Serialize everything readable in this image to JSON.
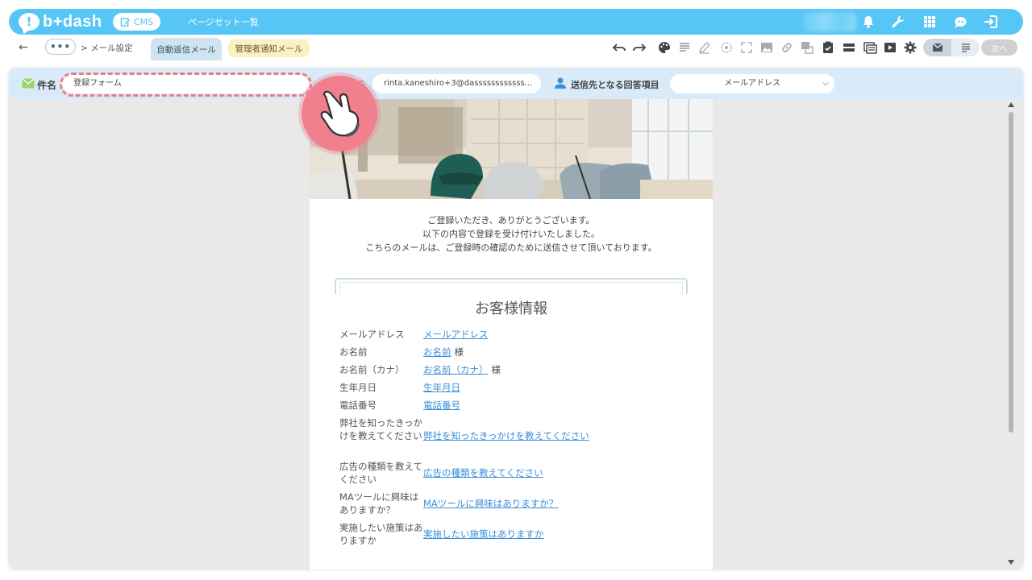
{
  "header": {
    "logo_text": "b+dash",
    "logo_mark": "!",
    "cms_label": "CMS",
    "nav_link": "ページセット一覧",
    "icons": [
      "bell-icon",
      "wrench-icon",
      "grid-icon",
      "support-icon",
      "logout-icon"
    ]
  },
  "toolbar": {
    "back": "←",
    "more": "•••",
    "breadcrumb": "> メール設定",
    "tabs": [
      {
        "label": "自動返信メール",
        "active": true
      },
      {
        "label": "管理者通知メール",
        "active": false
      }
    ],
    "next_label": "次へ"
  },
  "subject_bar": {
    "subject_label": "件名",
    "subject_value": "登録フォーム",
    "sender_label_fragment": "元",
    "sender_value": "rinta.kaneshiro+3@dassssssssssss...",
    "recipient_label": "送信先となる回答項目",
    "recipient_value": "メールアドレス"
  },
  "email": {
    "greeting_lines": [
      "ご登録いただき、ありがとうございます。",
      "以下の内容で登録を受け付けいたしました。",
      "こちらのメールは、ご登録時の確認のために送信させて頂いております。"
    ],
    "section_title": "お客様情報",
    "honorific": "様",
    "rows": [
      {
        "label": "メールアドレス",
        "value": "メールアドレス"
      },
      {
        "label": "お名前",
        "value": "お名前"
      },
      {
        "label": "お名前（カナ）",
        "value": "お名前（カナ）"
      },
      {
        "label": "生年月日",
        "value": "生年月日"
      },
      {
        "label": "電話番号",
        "value": "電話番号"
      },
      {
        "label": "弊社を知ったきっかけを教えてください",
        "value": "弊社を知ったきっかけを教えてください"
      },
      {
        "label": "広告の種類を教えてください",
        "value": "広告の種類を教えてください"
      },
      {
        "label": "MAツールに興味はありますか？",
        "value": "MAツールに興味はありますか？"
      },
      {
        "label": "実施したい施策はありますか",
        "value": "実施したい施策はありますか"
      }
    ]
  },
  "colors": {
    "brand": "#55c6f5",
    "highlight": "#f07b88",
    "link": "#3a8fd8",
    "tab_active": "#cfe3f1",
    "tab_admin": "#fbefc4"
  }
}
